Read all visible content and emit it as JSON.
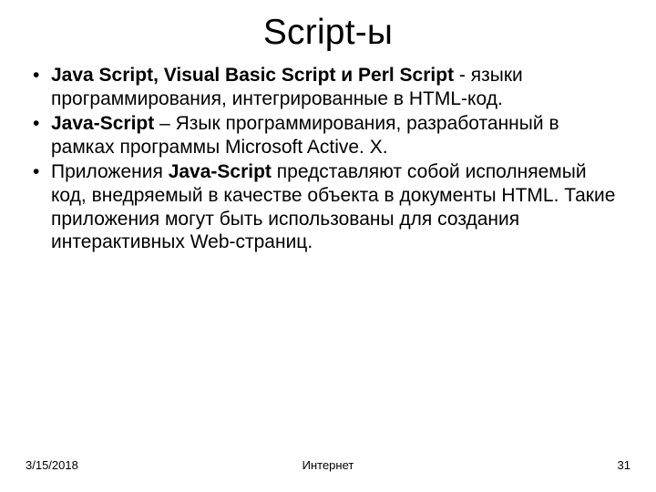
{
  "title": "Script-ы",
  "bullets": [
    {
      "b1": "Java Script, Visual Basic Script и Perl Script",
      "t1": " - языки программирования, интегрированные в HTML-код."
    },
    {
      "b1": "Java-Script",
      "t1": " – Язык программирования, разработанный в рамках программы Microsoft Active. X."
    },
    {
      "t0": "Приложения ",
      "b1": "Java-Script",
      "t1": " представляют собой исполняемый код, внедряемый в качестве объекта в документы HTML. Такие приложения могут быть использованы для создания интерактивных Web-страниц."
    }
  ],
  "footer": {
    "date": "3/15/2018",
    "center": "Интернет",
    "page": "31"
  }
}
